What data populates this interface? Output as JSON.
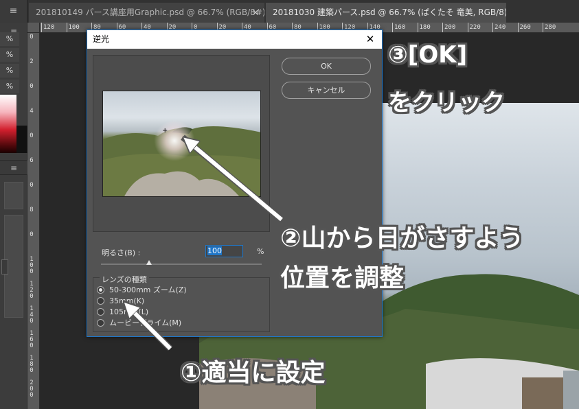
{
  "tabs": [
    {
      "label": "201810149 パース講座用Graphic.psd @ 66.7% (RGB/8#)",
      "close": "×"
    },
    {
      "label": "20181030 建築パース.psd @ 66.7% (ぱくたそ 竜美, RGB/8)",
      "close": ""
    }
  ],
  "tab_menu_icon": "≡",
  "left_panel": {
    "menu_icon": "≡",
    "percent_labels": [
      "%",
      "%",
      "%",
      "%"
    ],
    "swatch_colors": [
      "#ffffff",
      "#d2202e",
      "#000000"
    ]
  },
  "rulers": {
    "horizontal": [
      "120",
      "100",
      "80",
      "60",
      "40",
      "20",
      "0",
      "20",
      "40",
      "60",
      "80",
      "100",
      "120",
      "140",
      "160",
      "180",
      "200",
      "220",
      "240",
      "260",
      "280"
    ],
    "vertical": [
      "0",
      "2",
      "0",
      "4",
      "0",
      "6",
      "0",
      "8",
      "0",
      "100",
      "120",
      "140",
      "160",
      "180",
      "200"
    ]
  },
  "dialog": {
    "title": "逆光",
    "ok_label": "OK",
    "cancel_label": "キャンセル",
    "brightness_label": "明るさ(B) :",
    "brightness_value": "100",
    "brightness_unit": "%",
    "brightness_level": 0.3,
    "lens_group_label": "レンズの種類",
    "lens_options": [
      {
        "label": "50-300mm ズーム(Z)",
        "selected": true
      },
      {
        "label": "35mm(K)",
        "selected": false
      },
      {
        "label": "105mm(L)",
        "selected": false
      },
      {
        "label": "ムービープライム(M)",
        "selected": false
      }
    ],
    "accent_color": "#1f76c8"
  },
  "annotations": {
    "step3_line1": "③[OK]",
    "step3_line2": "をクリック",
    "step2_line1": "②山から日がさすよう",
    "step2_line2": "位置を調整",
    "step1": "①適当に設定"
  }
}
